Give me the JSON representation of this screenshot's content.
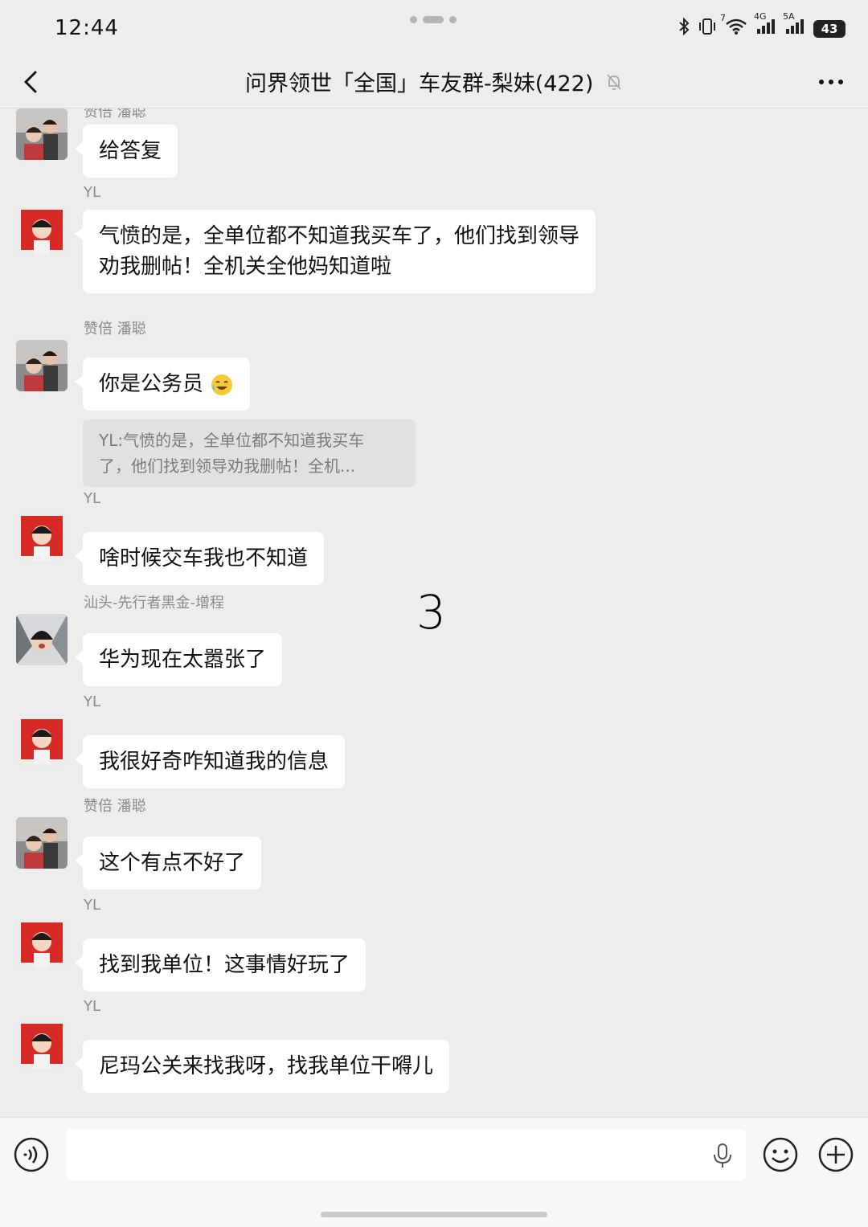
{
  "status_bar": {
    "time": "12:44",
    "network_1": "7",
    "network_2": "4G",
    "network_3": "5A",
    "battery": "43"
  },
  "header": {
    "title": "问界领世「全国」车友群-梨妹(422)",
    "icons": [
      "back-arrow-icon",
      "mute-bell-icon",
      "more-dots-icon"
    ]
  },
  "messages": [
    {
      "sender": "赞倍 潘聪",
      "text": "给答复",
      "avatar": "couple-photo"
    },
    {
      "sender": "YL",
      "text": "气愤的是，全单位都不知道我买车了，他们找到领导",
      "text2": "劝我删帖！全机关全他妈知道啦",
      "avatar": "red-shirt-child"
    },
    {
      "sender": "赞倍 潘聪",
      "text": "你是公务员",
      "emoji": "laugh-cry-emoji",
      "quote1": "YL:气愤的是，全单位都不知道我买车",
      "quote2": "了，他们找到领导劝我删帖！全机...",
      "avatar": "couple-photo"
    },
    {
      "sender": "YL",
      "text": "啥时候交车我也不知道",
      "avatar": "red-shirt-child"
    },
    {
      "sender": "汕头-先行者黑金-增程",
      "text": "华为现在太嚣张了",
      "avatar": "selfie-snow"
    },
    {
      "sender": "YL",
      "text": "我很好奇咋知道我的信息",
      "avatar": "red-shirt-child"
    },
    {
      "sender": "赞倍 潘聪",
      "text": "这个有点不好了",
      "avatar": "couple-photo"
    },
    {
      "sender": "YL",
      "text": "找到我单位！这事情好玩了",
      "avatar": "red-shirt-child"
    },
    {
      "sender": "YL",
      "text": "尼玛公关来找我呀，找我单位干嘚儿",
      "avatar": "red-shirt-child"
    }
  ],
  "overlay_number": "3",
  "input_bar": {
    "placeholder": "",
    "icons": [
      "voice-icon",
      "mic-icon",
      "emoji-icon",
      "plus-icon"
    ]
  }
}
